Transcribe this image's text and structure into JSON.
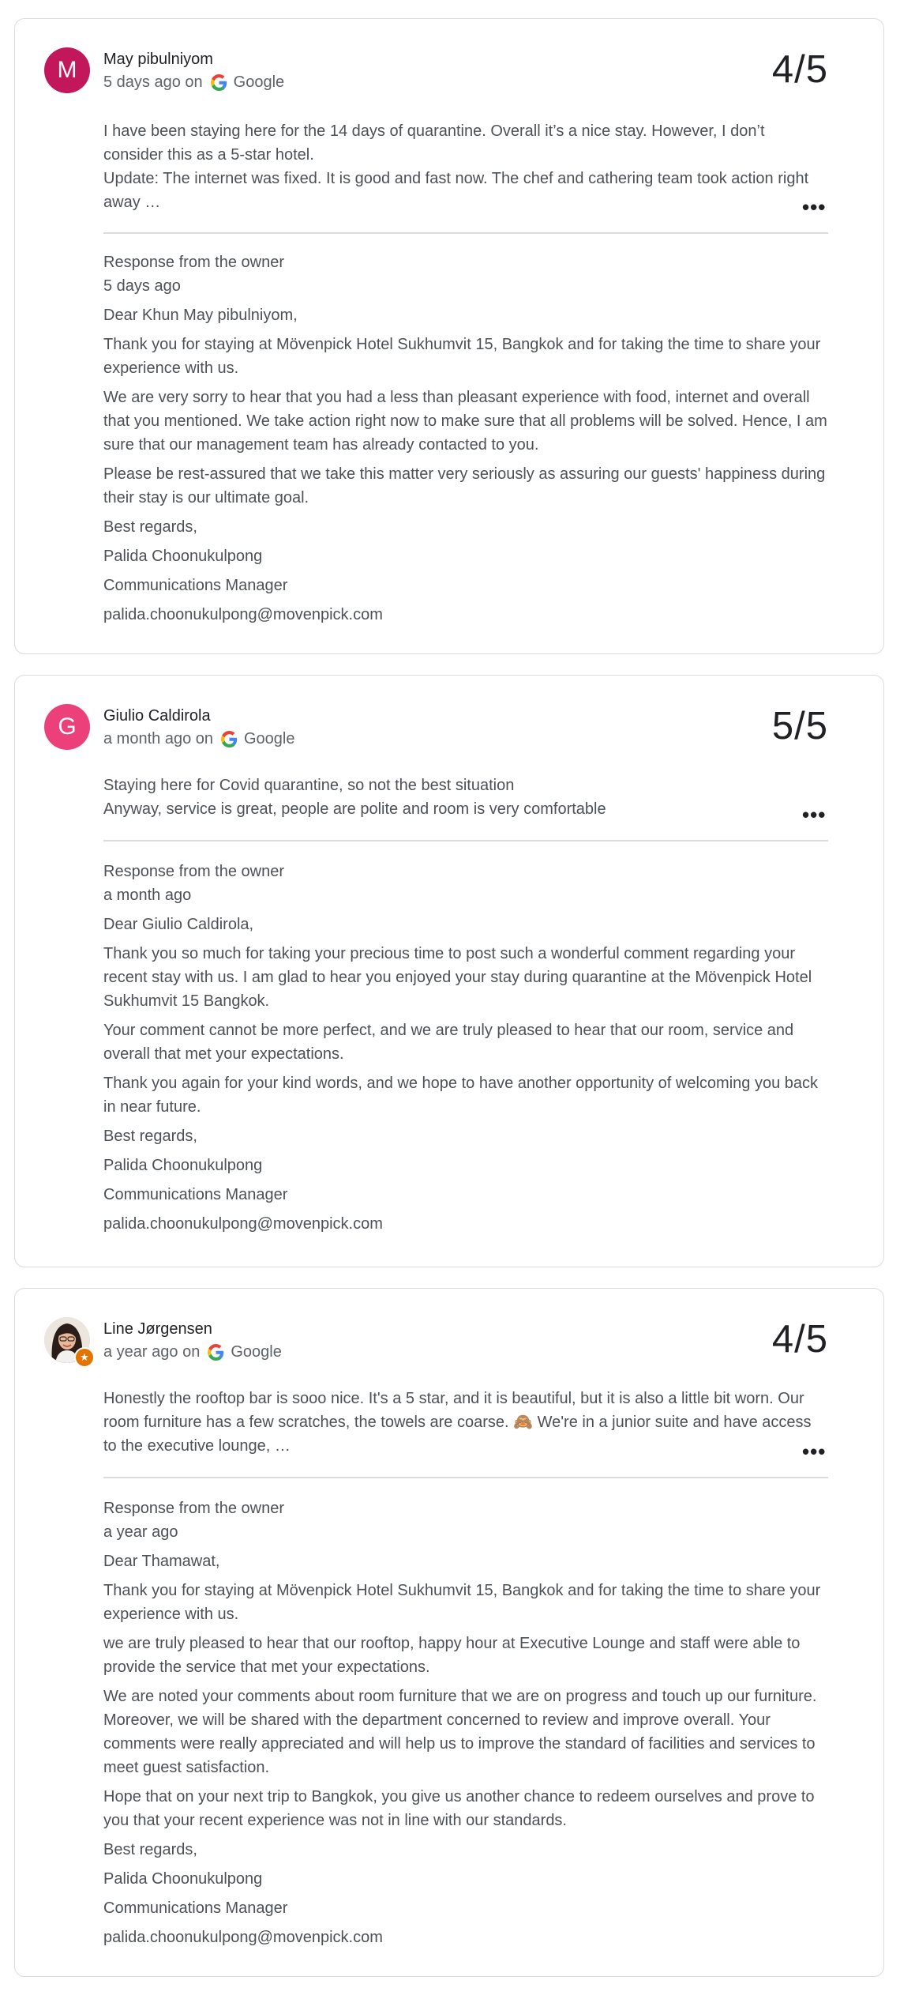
{
  "reviews": [
    {
      "author": "May pibulniyom",
      "avatar_letter": "M",
      "avatar_color": "#c2185b",
      "time": "5 days ago on",
      "source": "Google",
      "rating": "4/5",
      "text": [
        "I have been staying here for the 14 days of quarantine. Overall it’s a nice stay. However, I don’t consider this as a 5-star hotel.",
        "Update: The internet was fixed. It is good and fast now. The chef and cathering team took action right away …"
      ],
      "response": {
        "header": "Response from the owner",
        "time": "5 days ago",
        "paragraphs": [
          "Dear Khun May pibulniyom,",
          "Thank you for staying at Mövenpick Hotel Sukhumvit 15, Bangkok and for taking the time to share your experience with us.",
          "We are very sorry to hear that you had a less than pleasant experience with food, internet and overall that you mentioned. We take action right now to make sure that all problems will be solved. Hence, I am sure that our management team has already contacted to you.",
          "Please be rest-assured that we take this matter very seriously as assuring our guests' happiness during their stay is our ultimate goal.",
          "Best regards,",
          "Palida Choonukulpong",
          "Communications Manager",
          "palida.choonukulpong@movenpick.com"
        ]
      }
    },
    {
      "author": "Giulio Caldirola",
      "avatar_letter": "G",
      "avatar_color": "#ec407a",
      "time": "a month ago on",
      "source": "Google",
      "rating": "5/5",
      "text": [
        "Staying here for Covid quarantine, so not the best situation",
        "Anyway, service is great, people are polite and room is very comfortable"
      ],
      "response": {
        "header": "Response from the owner",
        "time": "a month ago",
        "paragraphs": [
          "Dear Giulio Caldirola,",
          "Thank you so much for taking your precious time to post such a wonderful comment regarding your recent stay with us. I am glad to hear you enjoyed your stay during quarantine at the Mövenpick Hotel Sukhumvit 15 Bangkok.",
          "Your comment cannot be more perfect, and we are truly pleased to hear that our room, service and overall that met your expectations.",
          "Thank you again for your kind words, and we hope to have another opportunity of welcoming you back in near future.",
          "Best regards,",
          "Palida Choonukulpong",
          "Communications Manager",
          "palida.choonukulpong@movenpick.com"
        ]
      }
    },
    {
      "author": "Line Jørgensen",
      "avatar_badge_color": "#e37400",
      "time": "a year ago on",
      "source": "Google",
      "rating": "4/5",
      "text": [
        "Honestly the rooftop bar is sooo nice. It's a 5 star, and it is beautiful, but it is also a little bit worn. Our room furniture has a few scratches, the towels are coarse. 🙈 We're in a junior suite and have access to the executive lounge, …"
      ],
      "response": {
        "header": "Response from the owner",
        "time": "a year ago",
        "paragraphs": [
          "Dear Thamawat,",
          "Thank you for staying at Mövenpick Hotel Sukhumvit 15, Bangkok and for taking the time to share your experience with us.",
          "we are truly pleased to hear that our rooftop, happy hour at Executive Lounge and staff were able to provide the service that met your expectations.",
          "We are noted your comments about room furniture that we are on progress and touch up our furniture. Moreover, we will be shared with the department concerned to review and improve overall. Your comments were really appreciated and will help us to improve the standard of facilities and services to meet guest satisfaction.",
          "Hope that on your next trip to Bangkok, you give us another chance to redeem ourselves and prove to you that your recent experience was not in line with our standards.",
          "Best regards,",
          "Palida Choonukulpong",
          "Communications Manager",
          "palida.choonukulpong@movenpick.com"
        ]
      }
    }
  ],
  "icons": {
    "more": "more-horizontal-icon",
    "source": "google-g-icon",
    "badge": "local-guide-star-icon"
  },
  "colors": {
    "google_blue": "#4285f4",
    "google_red": "#ea4335",
    "google_yellow": "#fbbc05",
    "google_green": "#34a853"
  }
}
